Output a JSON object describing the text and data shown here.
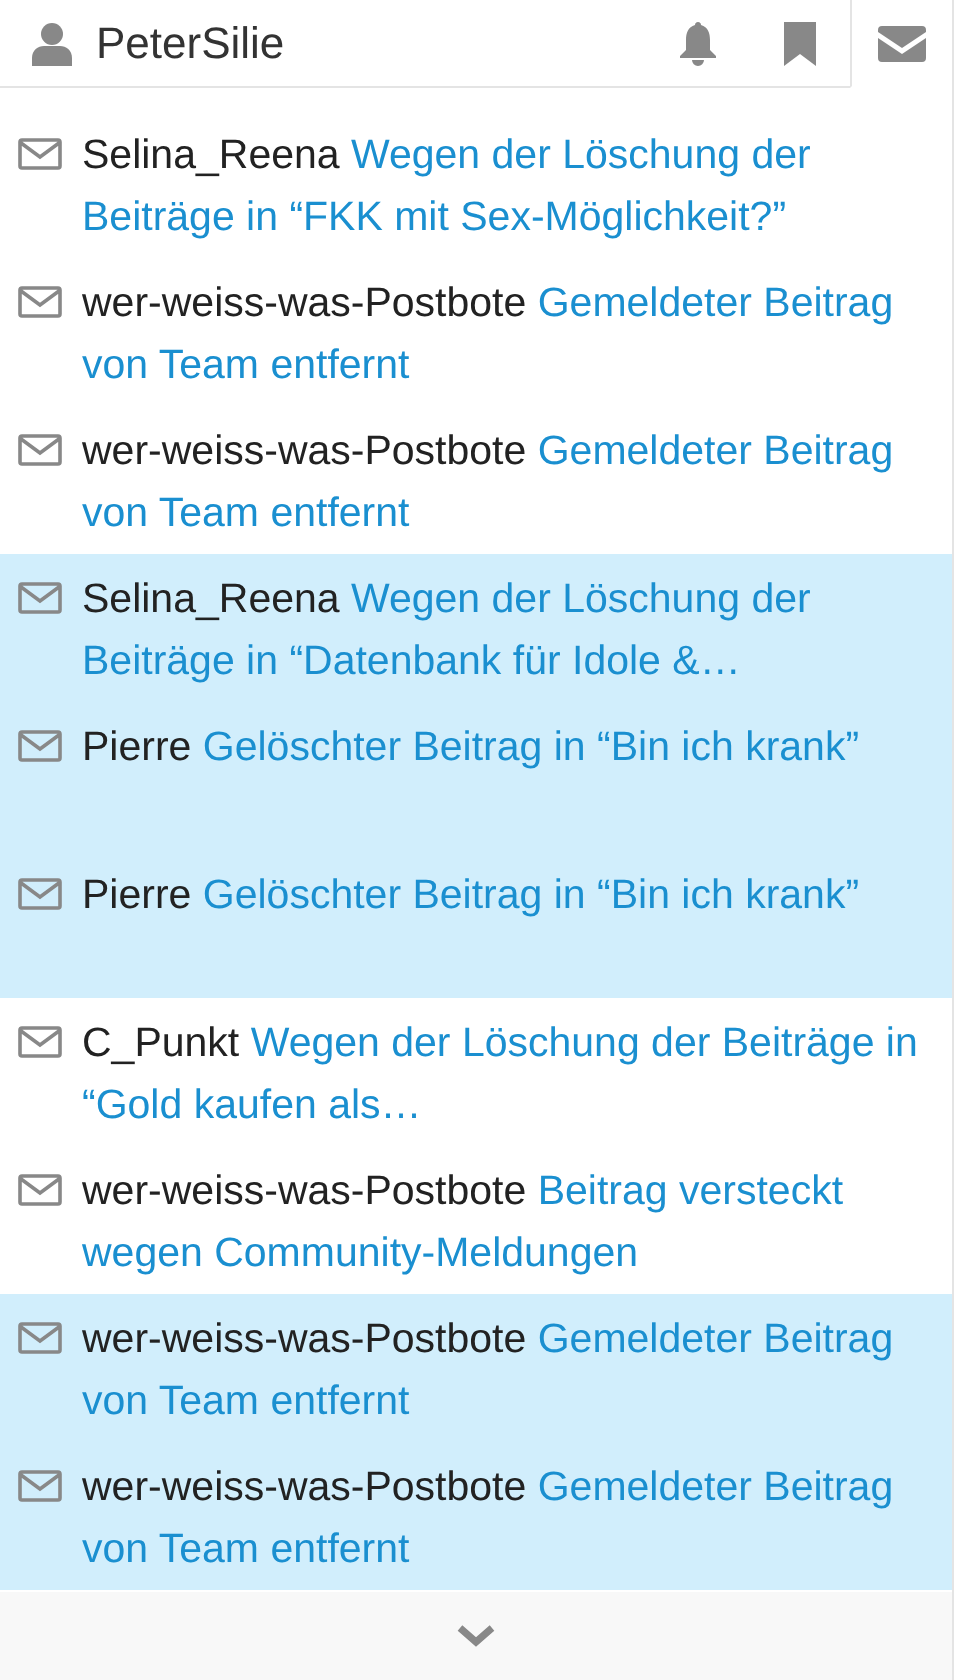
{
  "header": {
    "username": "PeterSilie"
  },
  "tabs": [
    {
      "kind": "bell",
      "selected": false
    },
    {
      "kind": "bookmark",
      "selected": false
    },
    {
      "kind": "mail",
      "selected": true
    }
  ],
  "messages": [
    {
      "sender": "Selina_Reena",
      "subject": "Wegen der Löschung der Beiträge in “FKK mit Sex-Möglichkeit?”",
      "unread": false
    },
    {
      "sender": "wer-weiss-was-Postbote",
      "subject": "Gemeldeter Beitrag von Team entfernt",
      "unread": false
    },
    {
      "sender": "wer-weiss-was-Postbote",
      "subject": "Gemeldeter Beitrag von Team entfernt",
      "unread": false
    },
    {
      "sender": "Selina_Reena",
      "subject": "Wegen der Löschung der Beiträge in “Datenbank für Idole &…",
      "unread": true
    },
    {
      "sender": "Pierre",
      "subject": "Gelöschter Beitrag in “Bin ich krank”",
      "unread": true
    },
    {
      "sender": "Pierre",
      "subject": "Gelöschter Beitrag in “Bin ich krank”",
      "unread": true
    },
    {
      "sender": "C_Punkt",
      "subject": "Wegen der Löschung der Beiträge in “Gold kaufen als…",
      "unread": false
    },
    {
      "sender": "wer-weiss-was-Postbote",
      "subject": "Beitrag versteckt wegen Community-Meldungen",
      "unread": false
    },
    {
      "sender": "wer-weiss-was-Postbote",
      "subject": "Gemeldeter Beitrag von Team entfernt",
      "unread": true
    },
    {
      "sender": "wer-weiss-was-Postbote",
      "subject": "Gemeldeter Beitrag von Team entfernt",
      "unread": true
    }
  ]
}
